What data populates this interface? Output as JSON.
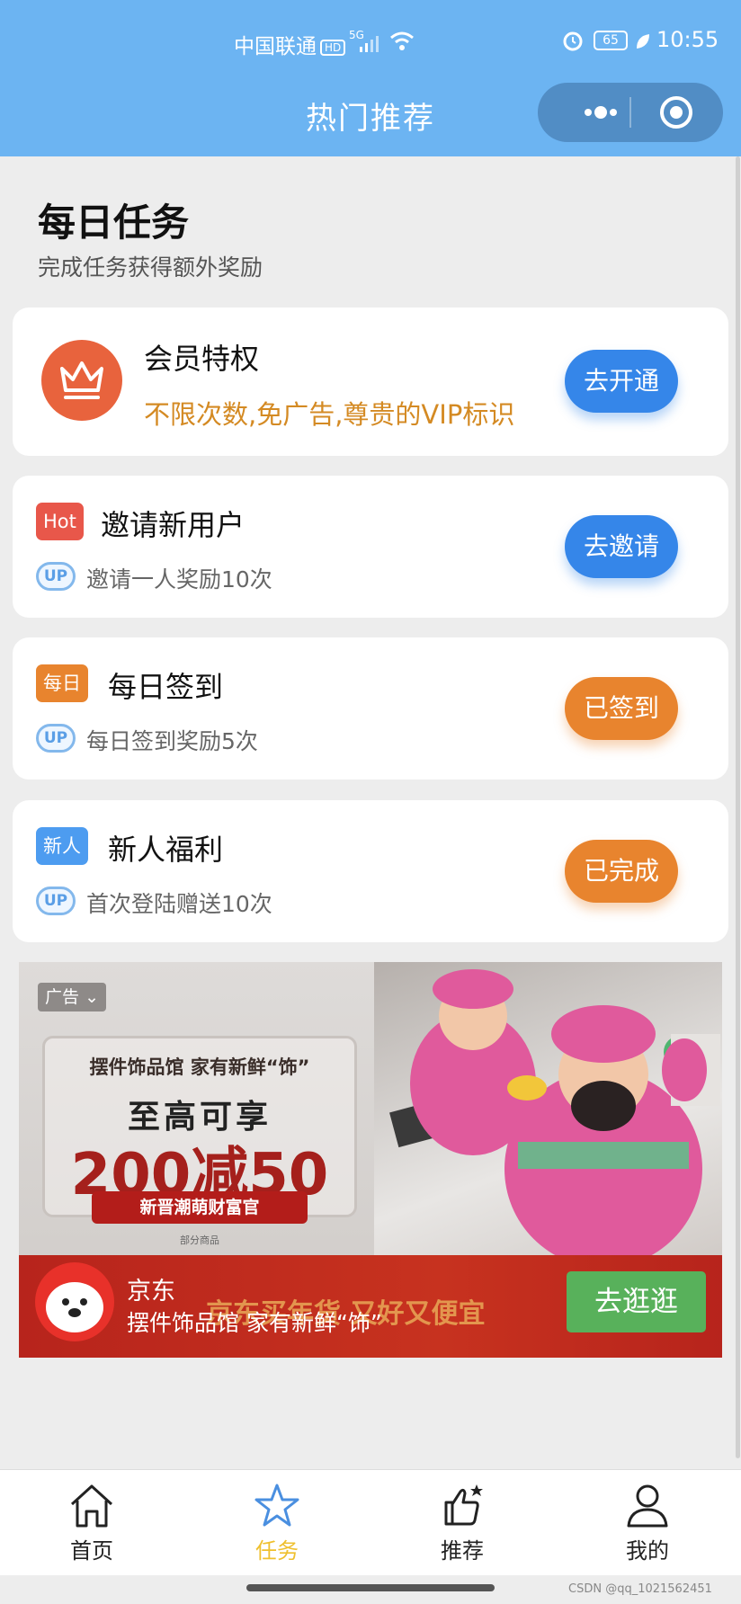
{
  "status_bar": {
    "carrier": "中国联通",
    "hd": "HD",
    "network": "5G",
    "battery": "65",
    "time": "10:55"
  },
  "nav": {
    "title": "热门推荐"
  },
  "header": {
    "title": "每日任务",
    "subtitle": "完成任务获得额外奖励"
  },
  "vip": {
    "title": "会员特权",
    "description": "不限次数,免广告,尊贵的VIP标识",
    "button": "去开通"
  },
  "tasks": [
    {
      "tag": "Hot",
      "tag_color": "#e8574a",
      "title": "邀请新用户",
      "badge": "UP",
      "description": "邀请一人奖励10次",
      "button": "去邀请"
    },
    {
      "tag": "每日",
      "tag_color": "#e8842e",
      "title": "每日签到",
      "badge": "UP",
      "description": "每日签到奖励5次",
      "button": "已签到"
    },
    {
      "tag": "新人",
      "tag_color": "#4d9cf0",
      "title": "新人福利",
      "badge": "UP",
      "description": "首次登陆赠送10次",
      "button": "已完成"
    }
  ],
  "ad": {
    "tag": "广告",
    "promo_line1": "摆件饰品馆  家有新鲜“饰”",
    "promo_line2": "至高可享",
    "promo_line3": "200减50",
    "promo_ribbon": "新晋潮萌财富官",
    "promo_note": "部分商品",
    "brand": "京东",
    "description": "摆件饰品馆 家有新鲜“饰”",
    "slogan": "京东买年货 又好又便宜",
    "button": "去逛逛"
  },
  "tabbar": {
    "items": [
      {
        "label": "首页",
        "icon": "home-icon"
      },
      {
        "label": "任务",
        "icon": "star-icon",
        "active": true
      },
      {
        "label": "推荐",
        "icon": "thumbs-up-icon"
      },
      {
        "label": "我的",
        "icon": "user-icon"
      }
    ],
    "active_color": "#efc02e"
  },
  "watermark": "CSDN @qq_1021562451",
  "colors": {
    "nav_bg": "#6cb4f2",
    "primary_button": "#3586e9",
    "done_button": "#e8842e",
    "vip_accent": "#d48a23"
  }
}
